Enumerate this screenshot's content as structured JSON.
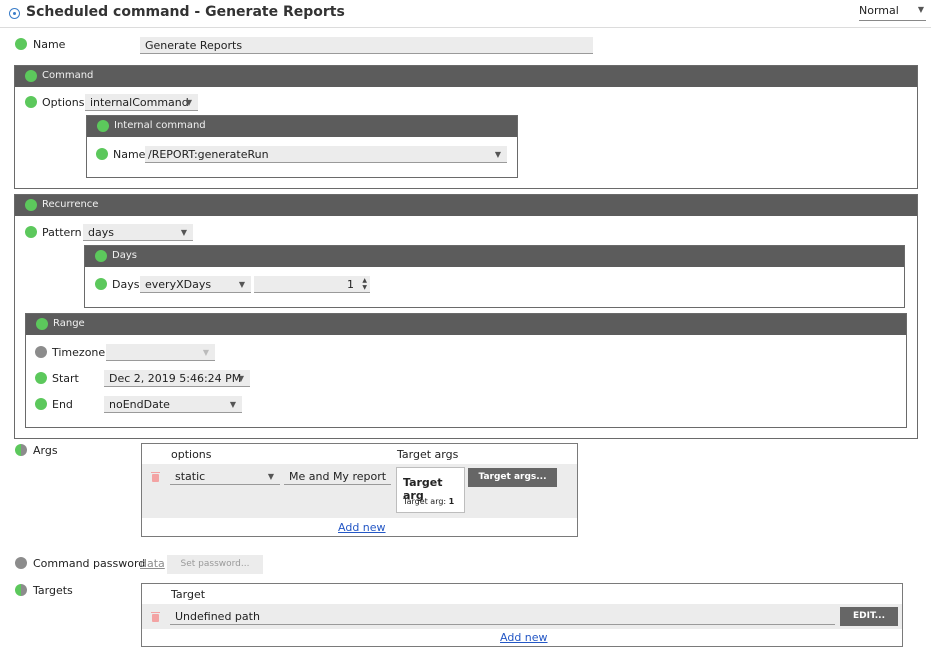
{
  "window": {
    "title": "Scheduled command - Generate Reports",
    "mode": "Normal"
  },
  "name": {
    "label": "Name",
    "value": "Generate Reports"
  },
  "command": {
    "header": "Command",
    "options_label": "Options",
    "options_value": "internalCommand",
    "internal": {
      "header": "Internal command",
      "name_label": "Name",
      "name_value": "/REPORT:generateRun"
    }
  },
  "recurrence": {
    "header": "Recurrence",
    "pattern_label": "Pattern",
    "pattern_value": "days",
    "days": {
      "header": "Days",
      "label": "Days",
      "mode": "everyXDays",
      "count": "1"
    },
    "range": {
      "header": "Range",
      "timezone_label": "Timezone",
      "timezone_value": "",
      "start_label": "Start",
      "start_value": "Dec 2, 2019 5:46:24 PM",
      "end_label": "End",
      "end_value": "noEndDate"
    }
  },
  "args": {
    "label": "Args",
    "col_options": "options",
    "col_target_args": "Target args",
    "row": {
      "type": "static",
      "value": "Me and My report",
      "target_arg_title": "Target arg",
      "target_arg_label": "Target arg: ",
      "target_arg_value": "1",
      "button": "Target args..."
    },
    "add_new": "Add new"
  },
  "command_password": {
    "label": "Command password",
    "link": "data",
    "button": "Set password..."
  },
  "targets": {
    "label": "Targets",
    "col_target": "Target",
    "row_value": "Undefined path",
    "edit_button": "EDIT...",
    "add_new": "Add new"
  }
}
